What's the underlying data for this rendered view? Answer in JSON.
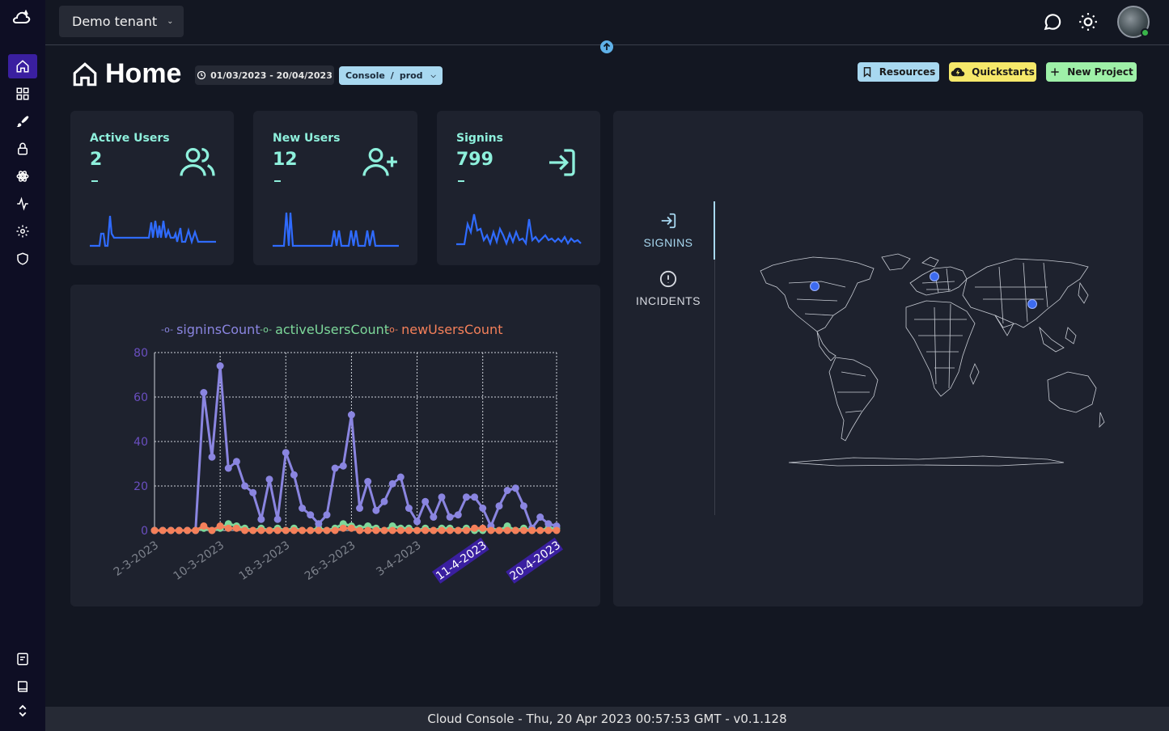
{
  "topbar": {
    "tenant_label": "Demo tenant"
  },
  "header": {
    "title": "Home",
    "date_range": "01/03/2023 - 20/04/2023",
    "env": {
      "product": "Console",
      "separator": "/",
      "stage": "prod"
    },
    "buttons": {
      "resources": "Resources",
      "quickstarts": "Quickstarts",
      "new_project": "New Project"
    }
  },
  "colors": {
    "accent_teal": "#8ef0dc",
    "signins": "#8a85e0",
    "active_users": "#7dd89a",
    "new_users": "#f5805a",
    "spark_blue": "#2f6bff"
  },
  "stats": [
    {
      "label": "Active Users",
      "value": "2",
      "icon": "users-icon"
    },
    {
      "label": "New Users",
      "value": "12",
      "icon": "user-plus-icon"
    },
    {
      "label": "Signins",
      "value": "799",
      "icon": "sign-in-icon"
    }
  ],
  "chart_data": {
    "type": "line",
    "x": [
      "2-3-2023",
      "3-3-2023",
      "4-3-2023",
      "5-3-2023",
      "6-3-2023",
      "7-3-2023",
      "8-3-2023",
      "9-3-2023",
      "10-3-2023",
      "11-3-2023",
      "12-3-2023",
      "13-3-2023",
      "14-3-2023",
      "15-3-2023",
      "16-3-2023",
      "17-3-2023",
      "18-3-2023",
      "19-3-2023",
      "20-3-2023",
      "21-3-2023",
      "22-3-2023",
      "23-3-2023",
      "24-3-2023",
      "25-3-2023",
      "26-3-2023",
      "27-3-2023",
      "28-3-2023",
      "29-3-2023",
      "30-3-2023",
      "31-3-2023",
      "1-4-2023",
      "2-4-2023",
      "3-4-2023",
      "4-4-2023",
      "5-4-2023",
      "6-4-2023",
      "7-4-2023",
      "8-4-2023",
      "9-4-2023",
      "10-4-2023",
      "11-4-2023",
      "12-4-2023",
      "13-4-2023",
      "14-4-2023",
      "15-4-2023",
      "16-4-2023",
      "17-4-2023",
      "18-4-2023",
      "19-4-2023",
      "20-4-2023"
    ],
    "xticks": [
      "2-3-2023",
      "10-3-2023",
      "18-3-2023",
      "26-3-2023",
      "3-4-2023",
      "11-4-2023",
      "20-4-2023"
    ],
    "series": [
      {
        "name": "signinsCount",
        "values": [
          0,
          0,
          0,
          0,
          0,
          0,
          62,
          33,
          74,
          28,
          31,
          20,
          17,
          5,
          23,
          5,
          35,
          25,
          10,
          7,
          3,
          7,
          28,
          29,
          52,
          10,
          22,
          9,
          13,
          21,
          24,
          10,
          4,
          13,
          6,
          15,
          6,
          7,
          15,
          15,
          10,
          2,
          11,
          18,
          19,
          11,
          1,
          6,
          3,
          2
        ]
      },
      {
        "name": "activeUsersCount",
        "values": [
          0,
          0,
          0,
          0,
          0,
          0,
          1,
          0,
          1,
          3,
          2,
          1,
          0,
          1,
          0,
          1,
          0,
          1,
          0,
          0,
          1,
          0,
          1,
          3,
          2,
          1,
          2,
          1,
          0,
          2,
          1,
          1,
          0,
          1,
          0,
          1,
          1,
          0,
          1,
          0,
          0,
          1,
          0,
          2,
          0,
          1,
          0,
          0,
          1,
          1
        ]
      },
      {
        "name": "newUsersCount",
        "values": [
          0,
          0,
          0,
          0,
          0,
          0,
          2,
          0,
          2,
          1,
          1,
          0,
          0,
          0,
          0,
          0,
          0,
          0,
          0,
          0,
          0,
          0,
          0,
          1,
          1,
          0,
          0,
          0,
          0,
          0,
          0,
          0,
          0,
          0,
          0,
          0,
          0,
          0,
          0,
          1,
          1,
          0,
          0,
          0,
          0,
          0,
          0,
          0,
          0,
          0
        ]
      }
    ],
    "ylim": [
      0,
      80
    ],
    "yticks": [
      0,
      20,
      40,
      60,
      80
    ],
    "legend": "top",
    "grid": true
  },
  "map_panel": {
    "tabs": [
      {
        "label": "SIGNINS",
        "icon": "sign-in-icon"
      },
      {
        "label": "INCIDENTS",
        "icon": "alert-circle-icon"
      }
    ],
    "markers": [
      "north-america",
      "europe",
      "asia"
    ]
  },
  "footer": {
    "text": "Cloud Console - Thu, 20 Apr 2023 00:57:53 GMT - v0.1.128"
  }
}
